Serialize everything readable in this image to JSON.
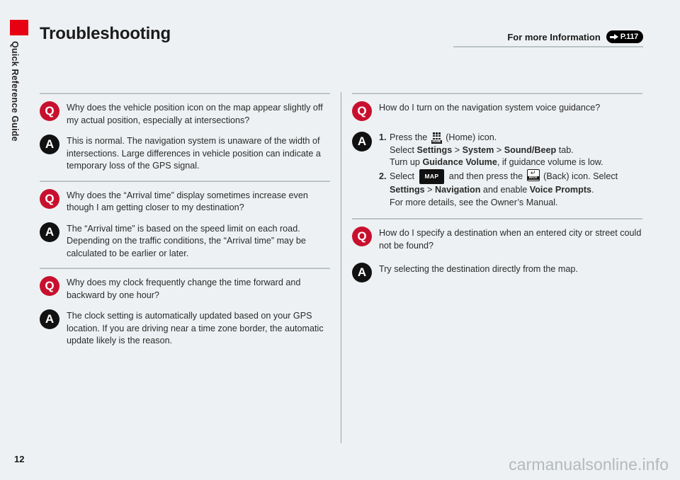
{
  "sidebar": {
    "label": "Quick Reference Guide",
    "accent_color": "#e60012"
  },
  "header": {
    "title": "Troubleshooting",
    "more_info_label": "For more Information",
    "reference_badge": {
      "icon": "arrow-right-icon",
      "text": "P.117"
    }
  },
  "footer": {
    "page_number": "12",
    "watermark": "carmanualsonline.info"
  },
  "colors": {
    "question_badge": "#c8102e",
    "answer_badge": "#111111",
    "page_background": "#eef1f3",
    "rule": "#b9c3c6"
  },
  "left_column": {
    "blocks": [
      {
        "q_badge": "Q",
        "a_badge": "A",
        "question": "Why does the vehicle position icon on the map appear slightly off my actual position, especially at intersections?",
        "answer": "This is normal. The navigation system is unaware of the width of intersections. Large differences in vehicle position can indicate a temporary loss of the GPS signal."
      },
      {
        "q_badge": "Q",
        "a_badge": "A",
        "question": "Why does the “Arrival time” display sometimes increase even though I am getting closer to my destination?",
        "answer": "The “Arrival time” is based on the speed limit on each road. Depending on the traffic conditions, the “Arrival time” may be calculated to be earlier or later."
      },
      {
        "q_badge": "Q",
        "a_badge": "A",
        "question": "Why does my clock frequently change the time forward and backward by one hour?",
        "answer": "The clock setting is automatically updated based on your GPS location. If you are driving near a time zone border, the automatic update likely is the reason."
      }
    ]
  },
  "right_column": {
    "block1": {
      "q_badge": "Q",
      "a_badge": "A",
      "question": "How do I turn on the navigation system voice guidance?",
      "steps": [
        {
          "number": "1.",
          "line1_before": "Press the ",
          "line1_icon": "home-icon",
          "line1_after": " (Home) icon.",
          "line2_prefix": "Select ",
          "line2_b1": "Settings",
          "line2_sep1": " > ",
          "line2_b2": "System",
          "line2_sep2": " > ",
          "line2_b3": "Sound/Beep",
          "line2_suffix": " tab.",
          "line3_prefix": "Turn up ",
          "line3_b1": "Guidance Volume",
          "line3_suffix": ", if guidance volume is low."
        },
        {
          "number": "2.",
          "line1_before": "Select ",
          "line1_icon": "map-button-icon",
          "line1_mid": " and then press the ",
          "line1_icon2": "back-icon",
          "line1_after": " (Back) icon. Select",
          "line2_b1": "Settings",
          "line2_sep1": " > ",
          "line2_b2": "Navigation",
          "line2_mid": " and enable ",
          "line2_b3": "Voice Prompts",
          "line2_suffix": ".",
          "line3": "For more details, see the Owner’s Manual."
        }
      ]
    },
    "block2": {
      "q_badge": "Q",
      "a_badge": "A",
      "question": "How do I specify a destination when an entered city or street could not be found?",
      "answer": "Try selecting the destination directly from the map."
    }
  },
  "icon_labels": {
    "map": "MAP",
    "home": "HOME",
    "back": "BACK"
  }
}
